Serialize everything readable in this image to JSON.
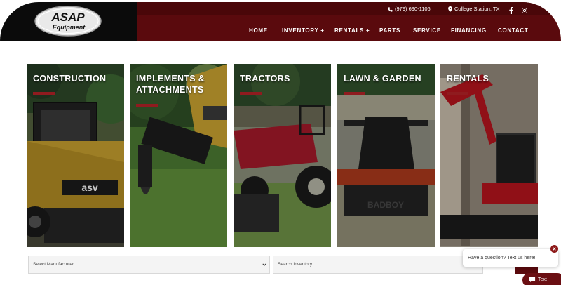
{
  "header": {
    "logo_text": "ASAP Equipment",
    "phone": "(979) 690-1106",
    "location": "College Station, TX",
    "social": [
      "facebook-icon",
      "instagram-icon"
    ],
    "nav": [
      {
        "label": "HOME"
      },
      {
        "label": "INVENTORY +"
      },
      {
        "label": "RENTALS +"
      },
      {
        "label": "PARTS"
      },
      {
        "label": "SERVICE"
      },
      {
        "label": "FINANCING"
      },
      {
        "label": "CONTACT"
      }
    ]
  },
  "categories": [
    {
      "line1": "CONSTRUCTION",
      "line2": ""
    },
    {
      "line1": "IMPLEMENTS &",
      "line2": "ATTACHMENTS"
    },
    {
      "line1": "TRACTORS",
      "line2": ""
    },
    {
      "line1": "LAWN & GARDEN",
      "line2": ""
    },
    {
      "line1": "RENTALS",
      "line2": ""
    }
  ],
  "search": {
    "manufacturer_label": "Select Manufacturer",
    "inventory_placeholder": "Search Inventory"
  },
  "chat": {
    "prompt": "Have a question? Text us here!",
    "button_label": "Text"
  },
  "colors": {
    "brand_red": "#5a0a0d",
    "accent_bar": "#8f1b1f",
    "logo_black": "#0b0b0b"
  }
}
